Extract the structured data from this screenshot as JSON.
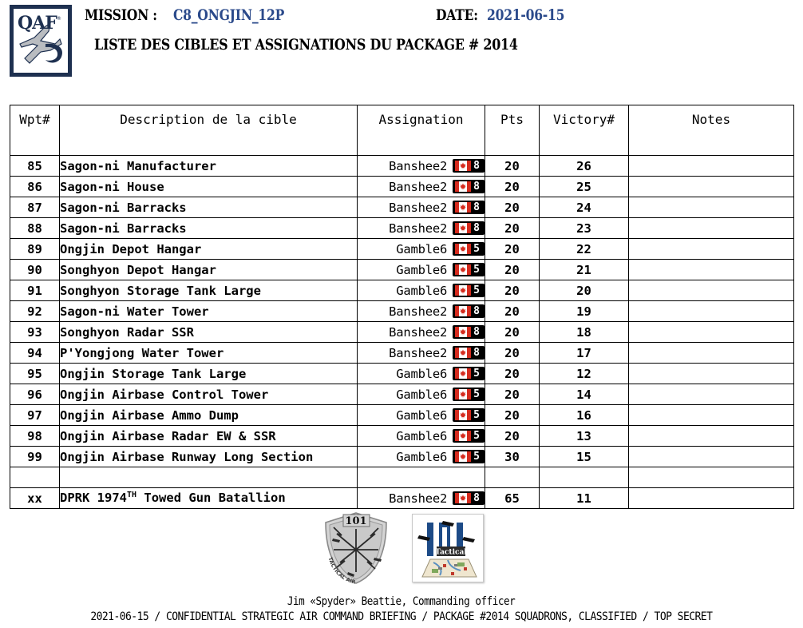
{
  "header": {
    "logo_icon": "qaf-jet-logo-icon",
    "logo_text": "QAF",
    "mission_label": "MISSION : ",
    "mission_value": "C8_ONGJIN_12P",
    "date_label": "DATE: ",
    "date_value": "2021-06-15",
    "subtitle": "LISTE DES CIBLES ET ASSIGNATIONS DU PACKAGE # 2014",
    "accent_color": "#2b4a8b",
    "logo_border_color": "#1e3050"
  },
  "table": {
    "columns": [
      "Wpt#",
      "Description de la cible",
      "Assignation",
      "Pts",
      "Victory#",
      "Notes"
    ],
    "flag_icon": "canada-flag-icon",
    "rows": [
      {
        "wpt": "85",
        "desc": "Sagon-ni Manufacturer",
        "squadron": "Banshee2",
        "count": "8",
        "pts": "20",
        "victory": "26",
        "notes": ""
      },
      {
        "wpt": "86",
        "desc": "Sagon-ni House",
        "squadron": "Banshee2",
        "count": "8",
        "pts": "20",
        "victory": "25",
        "notes": ""
      },
      {
        "wpt": "87",
        "desc": "Sagon-ni Barracks",
        "squadron": "Banshee2",
        "count": "8",
        "pts": "20",
        "victory": "24",
        "notes": ""
      },
      {
        "wpt": "88",
        "desc": "Sagon-ni Barracks",
        "squadron": "Banshee2",
        "count": "8",
        "pts": "20",
        "victory": "23",
        "notes": ""
      },
      {
        "wpt": "89",
        "desc": "Ongjin Depot Hangar",
        "squadron": "Gamble6",
        "count": "5",
        "pts": "20",
        "victory": "22",
        "notes": ""
      },
      {
        "wpt": "90",
        "desc": "Songhyon Depot Hangar",
        "squadron": "Gamble6",
        "count": "5",
        "pts": "20",
        "victory": "21",
        "notes": ""
      },
      {
        "wpt": "91",
        "desc": "Songhyon Storage Tank Large",
        "squadron": "Gamble6",
        "count": "5",
        "pts": "20",
        "victory": "20",
        "notes": ""
      },
      {
        "wpt": "92",
        "desc": "Sagon-ni Water Tower",
        "squadron": "Banshee2",
        "count": "8",
        "pts": "20",
        "victory": "19",
        "notes": ""
      },
      {
        "wpt": "93",
        "desc": "Songhyon Radar SSR",
        "squadron": "Banshee2",
        "count": "8",
        "pts": "20",
        "victory": "18",
        "notes": ""
      },
      {
        "wpt": "94",
        "desc": "P'Yongjong Water Tower",
        "squadron": "Banshee2",
        "count": "8",
        "pts": "20",
        "victory": "17",
        "notes": ""
      },
      {
        "wpt": "95",
        "desc": "Ongjin Storage Tank Large",
        "squadron": "Gamble6",
        "count": "5",
        "pts": "20",
        "victory": "12",
        "notes": ""
      },
      {
        "wpt": "96",
        "desc": "Ongjin Airbase Control Tower",
        "squadron": "Gamble6",
        "count": "5",
        "pts": "20",
        "victory": "14",
        "notes": ""
      },
      {
        "wpt": "97",
        "desc": "Ongjin Airbase Ammo Dump",
        "squadron": "Gamble6",
        "count": "5",
        "pts": "20",
        "victory": "16",
        "notes": ""
      },
      {
        "wpt": "98",
        "desc": "Ongjin Airbase Radar EW & SSR",
        "squadron": "Gamble6",
        "count": "5",
        "pts": "20",
        "victory": "13",
        "notes": ""
      },
      {
        "wpt": "99",
        "desc": "Ongjin Airbase Runway Long Section",
        "squadron": "Gamble6",
        "count": "5",
        "pts": "30",
        "victory": "15",
        "notes": ""
      },
      {
        "wpt": "",
        "desc": "",
        "squadron": "",
        "count": "",
        "pts": "",
        "victory": "",
        "notes": "",
        "spacer": true
      },
      {
        "wpt": "xx",
        "desc": "DPRK 1974TH Towed Gun Batallion",
        "desc_pre": "DPRK 1974",
        "desc_sup": "TH",
        "desc_post": " Towed Gun Batallion",
        "squadron": "Banshee2",
        "count": "8",
        "pts": "65",
        "victory": "11",
        "notes": ""
      }
    ]
  },
  "footer": {
    "emblem_tac_icon": "tactical-air-command-shield-icon",
    "emblem_tac_number": "101",
    "emblem_tac_ring_text": "TACTICAL AIR COMMAND",
    "emblem_101_icon": "101-tactical-squadron-logo-icon",
    "emblem_101_number": "101",
    "emblem_101_label": "Tactical",
    "officer_line": "Jim «Spyder» Beattie, Commanding officer",
    "classification_line": "2021-06-15 / CONFIDENTIAL STRATEGIC AIR COMMAND BRIEFING / PACKAGE #2014 SQUADRONS, CLASSIFIED / TOP SECRET"
  }
}
